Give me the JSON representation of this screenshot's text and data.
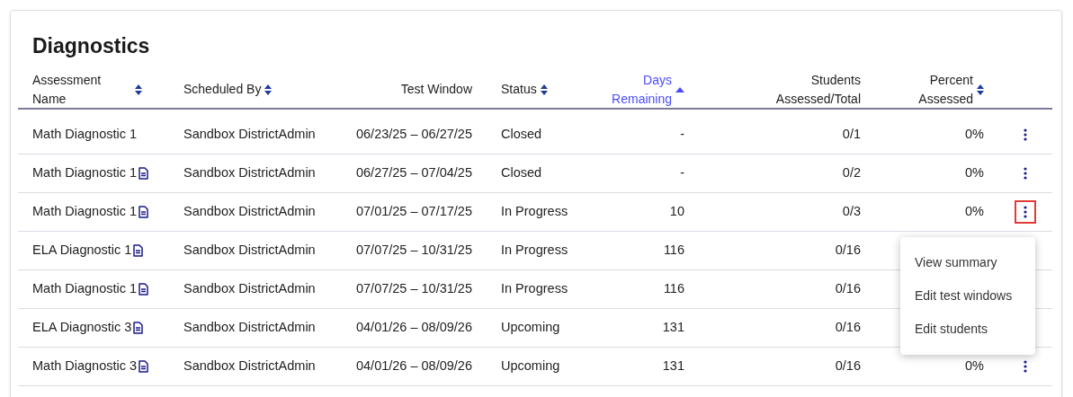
{
  "title": "Diagnostics",
  "columns": [
    {
      "label": "Assessment Name",
      "sortable": true,
      "selected": false
    },
    {
      "label": "Scheduled By",
      "sortable": true,
      "selected": false
    },
    {
      "label": "Test Window",
      "sortable": false,
      "selected": false
    },
    {
      "label": "Status",
      "sortable": true,
      "selected": false
    },
    {
      "label": "Days Remaining",
      "sortable": true,
      "selected": true
    },
    {
      "label": "Students Assessed/Total",
      "sortable": false,
      "selected": false
    },
    {
      "label": "Percent Assessed",
      "sortable": true,
      "selected": false
    }
  ],
  "rows": [
    {
      "name": "Math Diagnostic 1",
      "has_document": false,
      "scheduled_by": "Sandbox DistrictAdmin",
      "window": "06/23/25 – 06/27/25",
      "status": "Closed",
      "days": "-",
      "students": "0/1",
      "percent": "0%",
      "menu_button": true,
      "focused": false
    },
    {
      "name": "Math Diagnostic 1",
      "has_document": true,
      "scheduled_by": "Sandbox DistrictAdmin",
      "window": "06/27/25 – 07/04/25",
      "status": "Closed",
      "days": "-",
      "students": "0/2",
      "percent": "0%",
      "menu_button": true,
      "focused": false
    },
    {
      "name": "Math Diagnostic 1",
      "has_document": true,
      "scheduled_by": "Sandbox DistrictAdmin",
      "window": "07/01/25 – 07/17/25",
      "status": "In Progress",
      "days": "10",
      "students": "0/3",
      "percent": "0%",
      "menu_button": true,
      "focused": true
    },
    {
      "name": "ELA Diagnostic 1",
      "has_document": true,
      "scheduled_by": "Sandbox DistrictAdmin",
      "window": "07/07/25 – 10/31/25",
      "status": "In Progress",
      "days": "116",
      "students": "0/16",
      "menu_button": false,
      "focused": false
    },
    {
      "name": "Math Diagnostic 1",
      "has_document": true,
      "scheduled_by": "Sandbox DistrictAdmin",
      "window": "07/07/25 – 10/31/25",
      "status": "In Progress",
      "days": "116",
      "students": "0/16",
      "menu_button": false,
      "focused": false
    },
    {
      "name": "ELA Diagnostic 3",
      "has_document": true,
      "scheduled_by": "Sandbox DistrictAdmin",
      "window": "04/01/26 – 08/09/26",
      "status": "Upcoming",
      "days": "131",
      "students": "0/16",
      "menu_button": false,
      "focused": false
    },
    {
      "name": "Math Diagnostic 3",
      "has_document": true,
      "scheduled_by": "Sandbox DistrictAdmin",
      "window": "04/01/26 – 08/09/26",
      "status": "Upcoming",
      "days": "131",
      "students": "0/16",
      "percent": "0%",
      "menu_button": true,
      "focused": false
    }
  ],
  "menu": {
    "items": [
      "View summary",
      "Edit test windows",
      "Edit students"
    ]
  }
}
